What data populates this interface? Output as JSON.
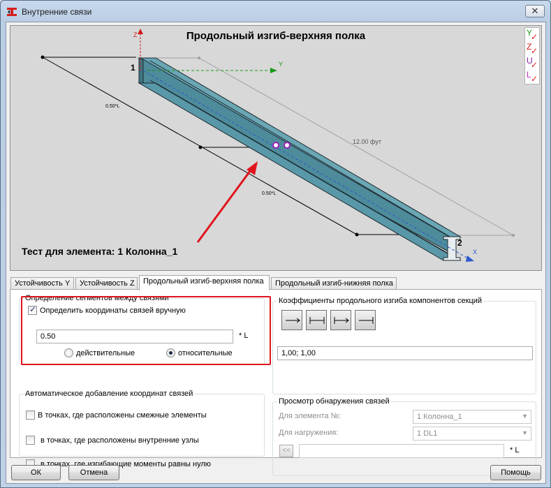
{
  "window": {
    "title": "Внутренние связи",
    "close_glyph": "✕"
  },
  "viewport": {
    "title": "Продольный изгиб-верхняя полка",
    "caption": "Тест для элемента: 1 Колонна_1",
    "node_start": "1",
    "node_end": "2",
    "axis_z": "Z",
    "axis_y": "Y",
    "axis_x": "X",
    "dim_length": "12.00  фут",
    "dim_left": "0.50*L",
    "dim_right": "0.50*L",
    "axis_toggles": [
      {
        "letter": "Y",
        "color": "#1a9a1a"
      },
      {
        "letter": "Z",
        "color": "#d01818"
      },
      {
        "letter": "U",
        "color": "#8a1aa8"
      },
      {
        "letter": "L",
        "color": "#c030c0"
      }
    ],
    "beam_color": "#4e8b9b",
    "annotation_arrow_color": "#e0141e"
  },
  "tabs": [
    {
      "label": "Устойчивость Y",
      "active": false
    },
    {
      "label": "Устойчивость Z",
      "active": false
    },
    {
      "label": "Продольный изгиб-верхняя полка",
      "active": true
    },
    {
      "label": "Продольный изгиб-нижняя полка",
      "active": false
    }
  ],
  "segments": {
    "legend": "Определение сегментов между связями",
    "manual_label": "Определить координаты связей вручную",
    "manual_checked": true,
    "value": "0.50",
    "unit": "* L",
    "radio_actual": "действительные",
    "radio_relative": "относительные",
    "relative_selected": true
  },
  "auto_add": {
    "legend": "Автоматическое добавление координат связей",
    "items": [
      "В точках, где расположены смежные элементы",
      "в точках, где расположены внутренние узлы",
      "в точках, где изгибающие моменты равны нулю"
    ]
  },
  "coefficients": {
    "legend": "Коэффициенты продольного изгиба компонентов секций",
    "value": "1,00; 1,00"
  },
  "detection": {
    "legend": "Просмотр обнаружения связей",
    "element_label": "Для элемента №:",
    "element_value": "1 Колонна_1",
    "load_label": "Для нагружения:",
    "load_value": "1 DL1",
    "back_label": "<<",
    "unit": "* L"
  },
  "buttons": {
    "ok": "ОК",
    "cancel": "Отмена",
    "help": "Помощь"
  }
}
